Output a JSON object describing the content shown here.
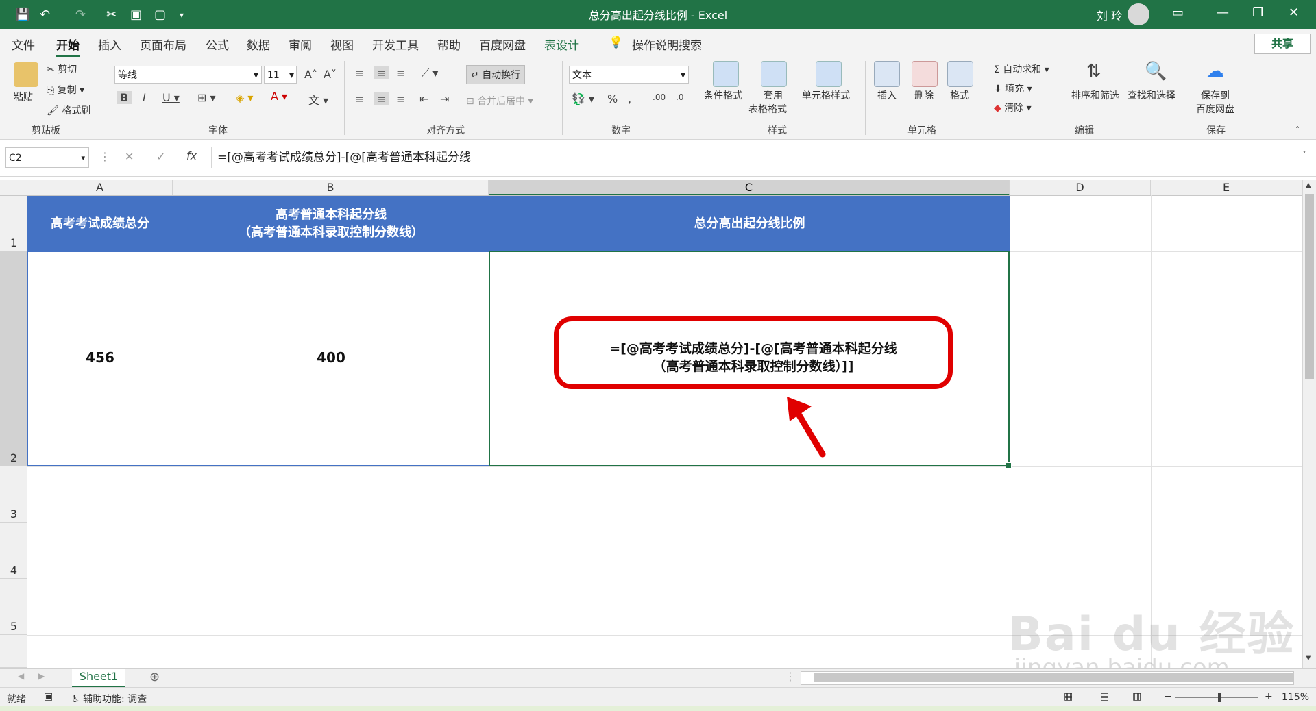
{
  "window": {
    "title": "总分高出起分线比例  -  Excel",
    "user": "刘 玲"
  },
  "tabs": [
    {
      "label": "文件"
    },
    {
      "label": "开始"
    },
    {
      "label": "插入"
    },
    {
      "label": "页面布局"
    },
    {
      "label": "公式"
    },
    {
      "label": "数据"
    },
    {
      "label": "审阅"
    },
    {
      "label": "视图"
    },
    {
      "label": "开发工具"
    },
    {
      "label": "帮助"
    },
    {
      "label": "百度网盘"
    },
    {
      "label": "表设计"
    }
  ],
  "tell_me": "操作说明搜索",
  "share_label": "共享",
  "ribbon": {
    "clipboard": {
      "paste": "粘贴",
      "cut": "剪切",
      "copy": "复制",
      "format_painter": "格式刷",
      "group": "剪贴板"
    },
    "font": {
      "name": "等线",
      "size": "11",
      "group": "字体"
    },
    "alignment": {
      "wrap": "自动换行",
      "merge": "合并后居中",
      "group": "对齐方式"
    },
    "number": {
      "format": "文本",
      "group": "数字"
    },
    "styles": {
      "conditional": "条件格式",
      "table1": "套用",
      "table2": "表格格式",
      "cell_styles": "单元格样式",
      "group": "样式"
    },
    "cells": {
      "insert": "插入",
      "delete": "删除",
      "format": "格式",
      "group": "单元格"
    },
    "editing": {
      "autosum": "自动求和",
      "fill": "填充",
      "clear": "清除",
      "sort": "排序和筛选",
      "find": "查找和选择",
      "group": "编辑"
    },
    "save": {
      "line1": "保存到",
      "line2": "百度网盘",
      "group": "保存"
    }
  },
  "formula_bar": {
    "name_box": "C2",
    "fx": "fx",
    "formula": "=[@高考考试成绩总分]-[@[高考普通本科起分线"
  },
  "columns": [
    "A",
    "B",
    "C",
    "D",
    "E"
  ],
  "rows": [
    "1",
    "2",
    "3",
    "4",
    "5"
  ],
  "table": {
    "headers": [
      "高考考试成绩总分",
      "高考普通本科起分线\n（高考普通本科录取控制分数线）",
      "总分高出起分线比例"
    ],
    "row": [
      "456",
      "400"
    ],
    "c2_line1": "=[@高考考试成绩总分]-[@[高考普通本科起分线",
    "c2_line2": "（高考普通本科录取控制分数线）]]"
  },
  "sheet_tab": "Sheet1",
  "status": {
    "ready": "就绪",
    "accessibility": "辅助功能: 调查",
    "zoom": "115%"
  },
  "watermark": {
    "brand": "Bai du 经验",
    "url": "jingyan.baidu.com"
  },
  "colors": {
    "excel_green": "#217346",
    "header_blue": "#4472c4",
    "highlight_red": "#e00000"
  }
}
